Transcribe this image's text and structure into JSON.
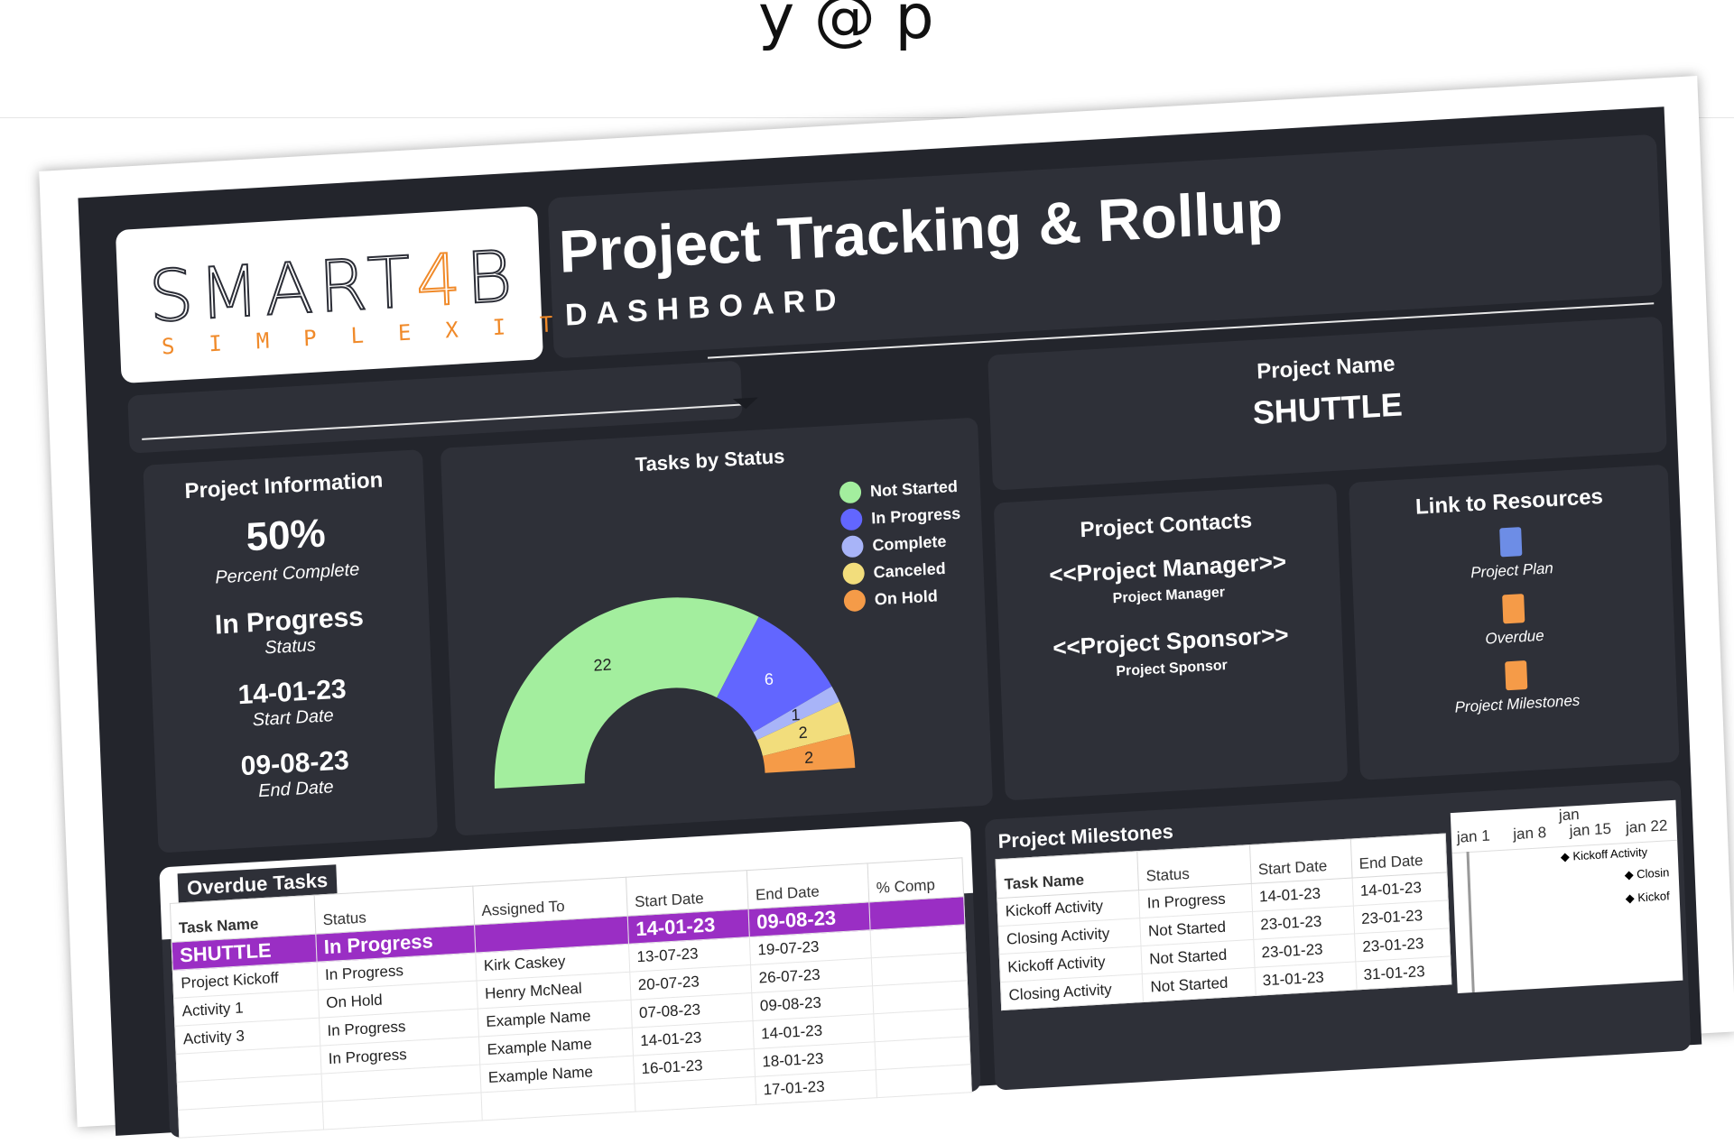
{
  "header": {
    "cut_text": "y     @    p"
  },
  "logo": {
    "main_a": "SMART",
    "main_b": "4",
    "main_c": "B",
    "sub": "SIMPLEXITY"
  },
  "title": {
    "main": "Project Tracking & Rollup",
    "sub": "DASHBOARD"
  },
  "project": {
    "name_label": "Project Name",
    "name": "SHUTTLE"
  },
  "info": {
    "heading": "Project Information",
    "percent": "50%",
    "percent_label": "Percent Complete",
    "status": "In Progress",
    "status_label": "Status",
    "start": "14-01-23",
    "start_label": "Start Date",
    "end": "09-08-23",
    "end_label": "End Date"
  },
  "chart_data": {
    "type": "pie",
    "title": "Tasks by Status",
    "categories": [
      "Not Started",
      "In Progress",
      "Complete",
      "Canceled",
      "On Hold"
    ],
    "values": [
      22,
      6,
      1,
      2,
      2
    ],
    "colors": [
      "#a3ee9e",
      "#6266ff",
      "#a8b4f8",
      "#f2dd7c",
      "#f59b48"
    ],
    "legend": "top-right",
    "shape": "half-donut"
  },
  "contacts": {
    "heading": "Project Contacts",
    "manager": "<<Project Manager>>",
    "manager_label": "Project Manager",
    "sponsor": "<<Project Sponsor>>",
    "sponsor_label": "Project Sponsor"
  },
  "resources": {
    "heading": "Link to Resources",
    "items": [
      {
        "label": "Project Plan",
        "icon": "document-icon",
        "color": "#5a7fe0"
      },
      {
        "label": "Overdue",
        "icon": "notebook-icon",
        "color": "#f59b48"
      },
      {
        "label": "Project Milestones",
        "icon": "notebook-icon",
        "color": "#f59b48"
      }
    ]
  },
  "overdue": {
    "heading": "Overdue Tasks",
    "columns": [
      "Task Name",
      "Status",
      "Assigned To",
      "Start Date",
      "End Date",
      "% Comp"
    ],
    "rows": [
      [
        "SHUTTLE",
        "In Progress",
        "",
        "14-01-23",
        "09-08-23",
        ""
      ],
      [
        "Project Kickoff",
        "In Progress",
        "Kirk Caskey",
        "13-07-23",
        "19-07-23",
        ""
      ],
      [
        "Activity 1",
        "On Hold",
        "Henry McNeal",
        "20-07-23",
        "26-07-23",
        ""
      ],
      [
        "Activity 3",
        "In Progress",
        "Example Name",
        "07-08-23",
        "09-08-23",
        ""
      ],
      [
        "",
        "In Progress",
        "Example Name",
        "14-01-23",
        "14-01-23",
        ""
      ],
      [
        "",
        "",
        "Example Name",
        "16-01-23",
        "18-01-23",
        ""
      ],
      [
        "",
        "",
        "",
        "",
        "17-01-23",
        ""
      ]
    ]
  },
  "milestones": {
    "heading": "Project Milestones",
    "columns": [
      "Task Name",
      "Status",
      "Start Date",
      "End Date"
    ],
    "rows": [
      [
        "Kickoff Activity",
        "In Progress",
        "14-01-23",
        "14-01-23"
      ],
      [
        "Closing Activity",
        "Not Started",
        "23-01-23",
        "23-01-23"
      ],
      [
        "Kickoff Activity",
        "Not Started",
        "23-01-23",
        "23-01-23"
      ],
      [
        "Closing Activity",
        "Not Started",
        "31-01-23",
        "31-01-23"
      ]
    ],
    "gantt": {
      "month": "jan",
      "weeks": [
        "jan 1",
        "jan 8",
        "jan 15",
        "jan 22"
      ],
      "markers": [
        "Kickoff Activity",
        "Closin",
        "Kickof"
      ]
    }
  }
}
